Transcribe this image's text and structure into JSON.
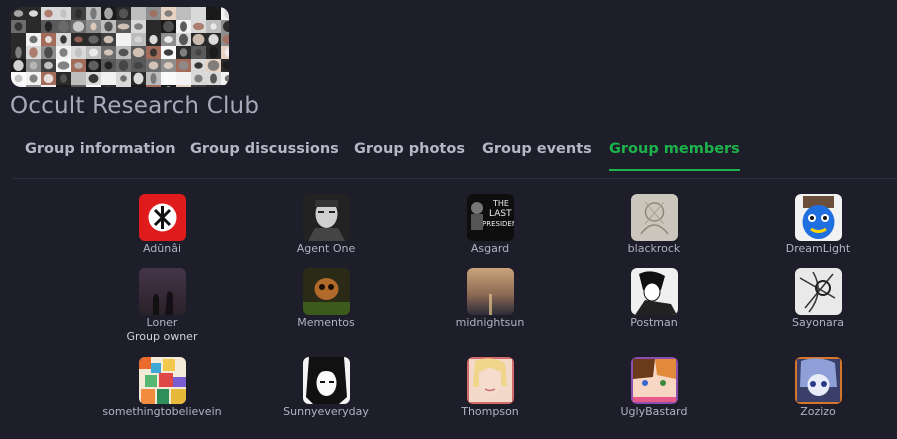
{
  "group": {
    "name": "Occult Research Club"
  },
  "tabs": [
    {
      "label": "Group information",
      "active": false
    },
    {
      "label": "Group discussions",
      "active": false
    },
    {
      "label": "Group photos",
      "active": false
    },
    {
      "label": "Group events",
      "active": false
    },
    {
      "label": "Group members",
      "active": true
    }
  ],
  "colors": {
    "background": "#1e1e2a",
    "accent": "#1bb34a",
    "text": "#b4b7c6"
  },
  "members": [
    {
      "name": "Adūnâi",
      "role": null,
      "avatar": "red-cross-symbol-icon"
    },
    {
      "name": "Agent One",
      "role": null,
      "avatar": "man-portrait-avatar"
    },
    {
      "name": "Asgard",
      "role": null,
      "avatar": "the-last-president-poster-avatar"
    },
    {
      "name": "blackrock",
      "role": null,
      "avatar": "sketch-avatar"
    },
    {
      "name": "DreamLight",
      "role": null,
      "avatar": "blue-character-avatar"
    },
    {
      "name": "Loner",
      "role": "Group owner",
      "avatar": "dusk-silhouette-avatar"
    },
    {
      "name": "Mementos",
      "role": null,
      "avatar": "skull-avatar"
    },
    {
      "name": "midnightsun",
      "role": null,
      "avatar": "sunset-sea-avatar"
    },
    {
      "name": "Postman",
      "role": null,
      "avatar": "manga-drawing-avatar"
    },
    {
      "name": "Sayonara",
      "role": null,
      "avatar": "ink-sketch-avatar"
    },
    {
      "name": "somethingtobelievein",
      "role": null,
      "avatar": "colorful-pixel-avatar"
    },
    {
      "name": "Sunnyeveryday",
      "role": null,
      "avatar": "anime-girl-bw-avatar"
    },
    {
      "name": "Thompson",
      "role": null,
      "avatar": "blonde-woman-avatar"
    },
    {
      "name": "UglyBastard",
      "role": null,
      "avatar": "anime-girls-color-avatar"
    },
    {
      "name": "Zozizo",
      "role": null,
      "avatar": "anime-blue-avatar"
    }
  ]
}
